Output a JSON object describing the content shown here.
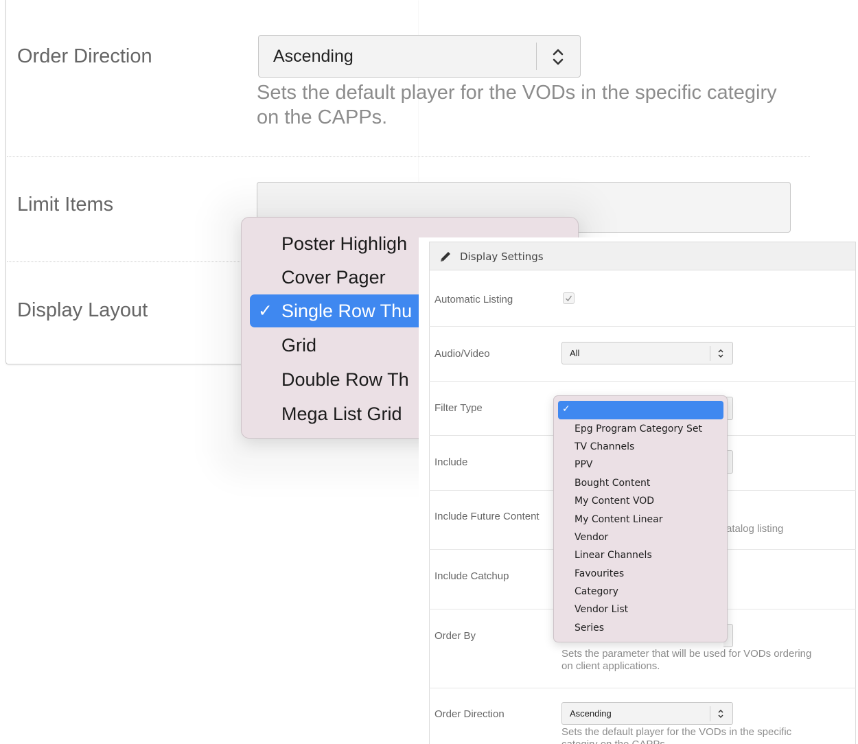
{
  "background_form": {
    "order_direction": {
      "label": "Order Direction",
      "value": "Ascending",
      "help": "Sets the default player for the VODs in the specific categiry on the CAPPs."
    },
    "limit_items": {
      "label": "Limit Items",
      "value": ""
    },
    "display_layout": {
      "label": "Display Layout",
      "options": [
        "Poster Highlight Slider",
        "Cover Pager",
        "Single Row Thumbnails",
        "Grid",
        "Double Row Thumbnails",
        "Mega List Grid"
      ],
      "visible_options": [
        "Poster Highligh",
        "Cover Pager",
        "Single Row Thu",
        "Grid",
        "Double Row Th",
        "Mega List Grid"
      ],
      "selected_index": 2,
      "check_glyph": "✓"
    }
  },
  "display_settings": {
    "title": "Display Settings",
    "header_icon": "pencil-icon",
    "rows": {
      "automatic_listing": {
        "label": "Automatic Listing",
        "checked": true
      },
      "audio_video": {
        "label": "Audio/Video",
        "value": "All"
      },
      "filter_type": {
        "label": "Filter Type",
        "options": [
          "Epg Program Category Set",
          "TV Channels",
          "PPV",
          "Bought Content",
          "My Content VOD",
          "My Content Linear",
          "Vendor",
          "Linear Channels",
          "Favourites",
          "Category",
          "Vendor List",
          "Series"
        ],
        "check_glyph": "✓"
      },
      "include": {
        "label": "Include"
      },
      "include_future_content": {
        "label": "Include Future Content",
        "help_fragment": "atalog listing"
      },
      "include_catchup": {
        "label": "Include Catchup"
      },
      "order_by": {
        "label": "Order By",
        "help": "Sets the parameter that will be used for VODs ordering on client applications."
      },
      "order_direction": {
        "label": "Order Direction",
        "value": "Ascending",
        "help": "Sets the default player for the VODs in the specific categiry on the CAPPs."
      }
    }
  },
  "colors": {
    "menu_bg": "#ebe0e5",
    "menu_selected": "#3f88f0",
    "label_text": "#666666",
    "help_text": "#8c8c8c"
  }
}
